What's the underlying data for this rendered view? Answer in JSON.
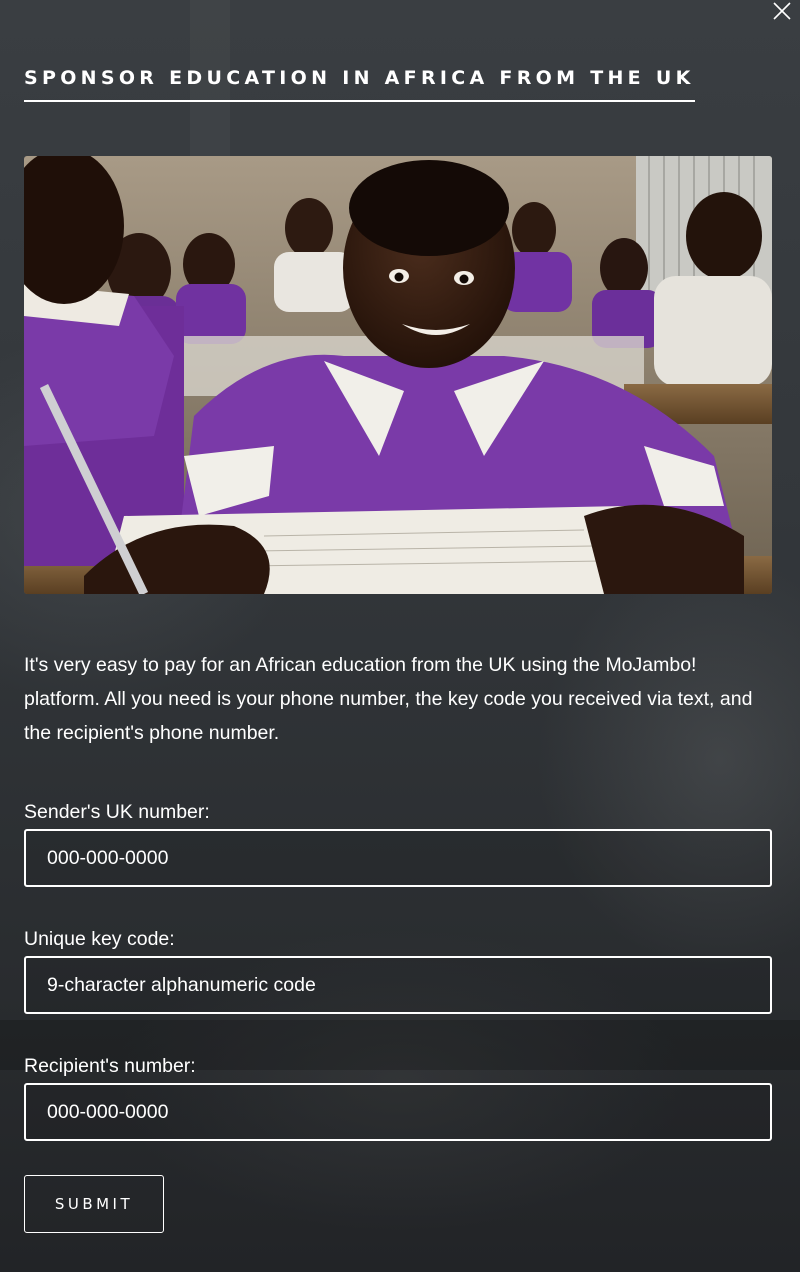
{
  "modal": {
    "title": "SPONSOR EDUCATION IN AFRICA FROM THE UK",
    "close_icon": "close-icon",
    "image_alt_icon": "classroom-photo"
  },
  "intro": {
    "text": "It's very easy to pay for an African education from the UK using the MoJambo! platform. All you need is your phone number, the key code you received via text, and the recipient's phone number."
  },
  "form": {
    "sender": {
      "label": "Sender's UK number:",
      "placeholder": "000-000-0000"
    },
    "key_code": {
      "label": "Unique key code:",
      "placeholder": "9-character alphanumeric code"
    },
    "recipient": {
      "label": "Recipient's number:",
      "placeholder": "000-000-0000"
    },
    "submit_label": "SUBMIT"
  },
  "colors": {
    "overlay": "#2e3236",
    "text": "#ffffff",
    "uniform_purple": "#7a3aa8"
  }
}
